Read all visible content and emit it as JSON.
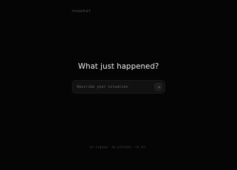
{
  "brand": {
    "logo_text": "nowwhat"
  },
  "main": {
    "headline": "What just happened?",
    "input": {
      "placeholder": "Describe your situation"
    },
    "submit_icon": "arrow-right-icon"
  },
  "footer": {
    "text": "no signup. no pitches. no bs."
  },
  "colors": {
    "background": "#050505",
    "headline": "#efefef",
    "input_background": "#111111",
    "muted_text": "#676767"
  }
}
